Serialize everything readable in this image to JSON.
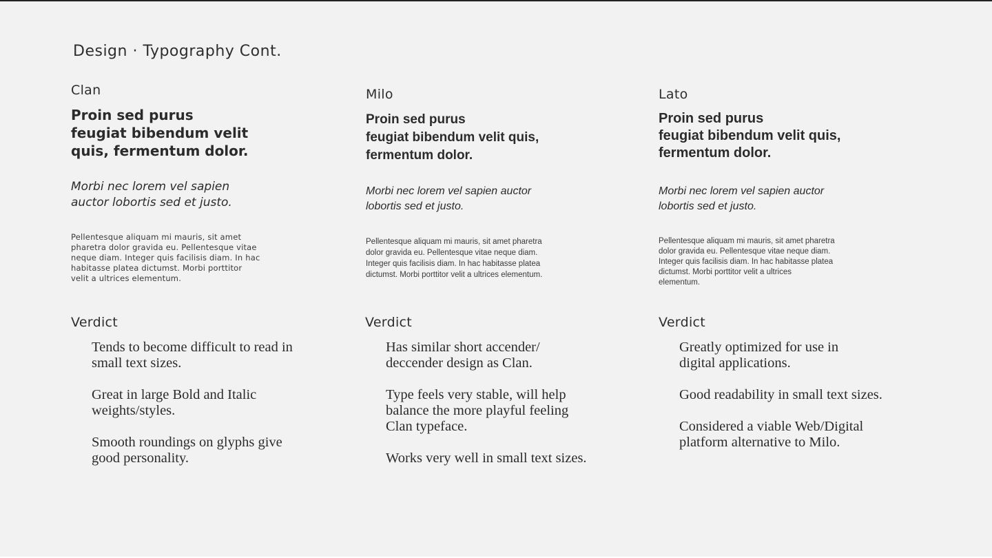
{
  "page": {
    "title": "Design · Typography Cont."
  },
  "columns": [
    {
      "font_name": "Clan",
      "bold_sample": [
        "Proin sed purus",
        "feugiat bibendum velit",
        "quis, fermentum dolor."
      ],
      "italic_sample": [
        "Morbi nec lorem vel sapien",
        "auctor lobortis sed et justo."
      ],
      "body_sample": [
        "Pellentesque aliquam mi mauris, sit amet",
        "pharetra dolor gravida eu. Pellentesque vitae",
        "neque diam. Integer quis facilisis diam. In hac",
        "habitasse platea dictumst. Morbi porttitor",
        "velit a ultrices elementum."
      ],
      "verdict_label": "Verdict",
      "verdict_points": [
        [
          "Tends to become difficult to read in",
          "small text sizes."
        ],
        [
          "Great in large Bold and Italic",
          "weights/styles."
        ],
        [
          "Smooth roundings on glyphs give",
          "good personality."
        ]
      ]
    },
    {
      "font_name": "Milo",
      "bold_sample": [
        "Proin sed purus",
        "feugiat bibendum velit quis,",
        "fermentum dolor."
      ],
      "italic_sample": [
        "Morbi nec lorem vel sapien auctor",
        "lobortis sed et justo."
      ],
      "body_sample": [
        "Pellentesque aliquam mi mauris, sit amet pharetra",
        "dolor gravida eu. Pellentesque vitae neque diam.",
        "Integer quis facilisis diam. In hac habitasse platea",
        "dictumst. Morbi porttitor velit a ultrices elementum."
      ],
      "verdict_label": "Verdict",
      "verdict_points": [
        [
          "Has similar short accender/",
          "deccender design as Clan."
        ],
        [
          "Type feels very stable, will help",
          "balance the more playful feeling",
          "Clan typeface."
        ],
        [
          "Works very well in small text sizes."
        ]
      ]
    },
    {
      "font_name": "Lato",
      "bold_sample": [
        "Proin sed purus",
        "feugiat bibendum velit quis,",
        "fermentum dolor."
      ],
      "italic_sample": [
        "Morbi nec lorem vel sapien auctor",
        "lobortis sed et justo."
      ],
      "body_sample": [
        "Pellentesque aliquam mi mauris, sit amet pharetra",
        "dolor gravida eu. Pellentesque vitae neque diam.",
        "Integer quis facilisis diam. In hac habitasse platea",
        "dictumst. Morbi porttitor velit a ultrices",
        "elementum."
      ],
      "verdict_label": "Verdict",
      "verdict_points": [
        [
          "Greatly optimized for use in",
          "digital applications."
        ],
        [
          "Good readability in small text sizes."
        ],
        [
          "Considered a viable Web/Digital",
          "platform alternative to Milo."
        ]
      ]
    }
  ]
}
